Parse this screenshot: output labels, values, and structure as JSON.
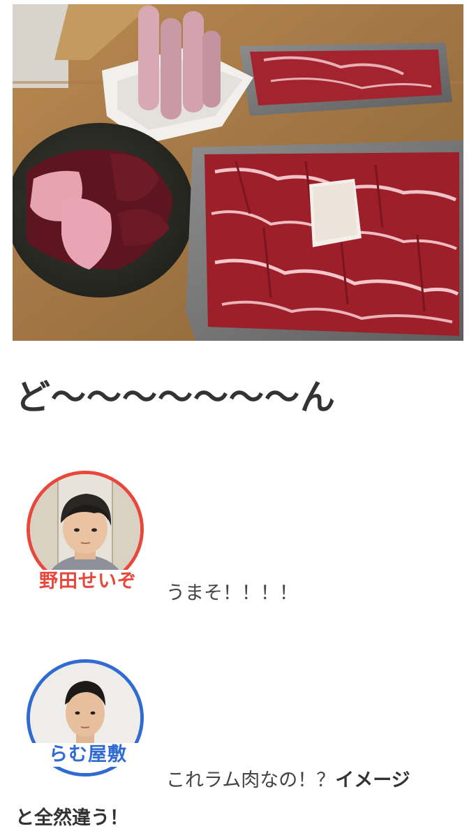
{
  "photo": {
    "alt_name": "lamb-meat-platter-photo"
  },
  "headline": {
    "text": "ど〜〜〜〜〜〜〜ん"
  },
  "dialogue": [
    {
      "speaker_name": "野田せいぞ",
      "ring_color": "#e8483c",
      "line": "うまそ！！！！"
    },
    {
      "speaker_name": "らむ屋敷",
      "ring_color": "#2f6bd3",
      "line_normal": "これラム肉なの！？",
      "line_bold_1": "イメージ",
      "line_bold_2": "と全然違う！"
    }
  ],
  "colors": {
    "text": "#444444",
    "speaker1_accent": "#e8483c",
    "speaker2_accent": "#2f6bd3"
  }
}
